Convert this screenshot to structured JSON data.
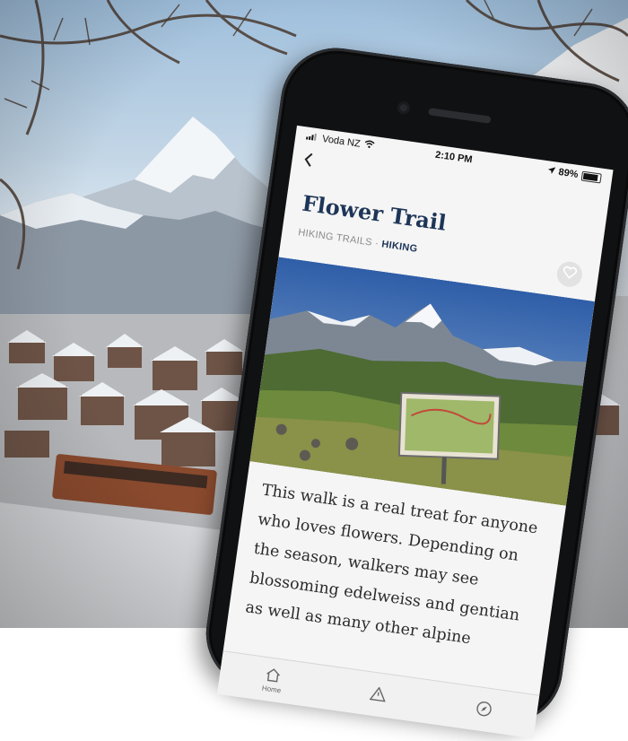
{
  "status_bar": {
    "carrier": "Voda NZ",
    "time": "2:10 PM",
    "battery": "89%"
  },
  "header": {
    "back_icon": "chevron-left-icon",
    "title": "Flower Trail"
  },
  "breadcrumb": {
    "category": "HIKING TRAILS",
    "separator": "·",
    "subcategory": "HIKING"
  },
  "favorite": {
    "icon": "heart-icon"
  },
  "article": {
    "body": "This walk is a real treat for anyone who loves flowers. Depending on the season, walkers may see blossoming edelweiss and gentian as well as many other alpine"
  },
  "tabbar": {
    "items": [
      {
        "label": "Home",
        "icon": "home-icon"
      },
      {
        "label": "",
        "icon": "warning-icon"
      },
      {
        "label": "",
        "icon": "compass-icon"
      }
    ]
  },
  "colors": {
    "title": "#1d3557",
    "crumb_active": "#1d3557",
    "crumb": "#8a8a8a"
  }
}
